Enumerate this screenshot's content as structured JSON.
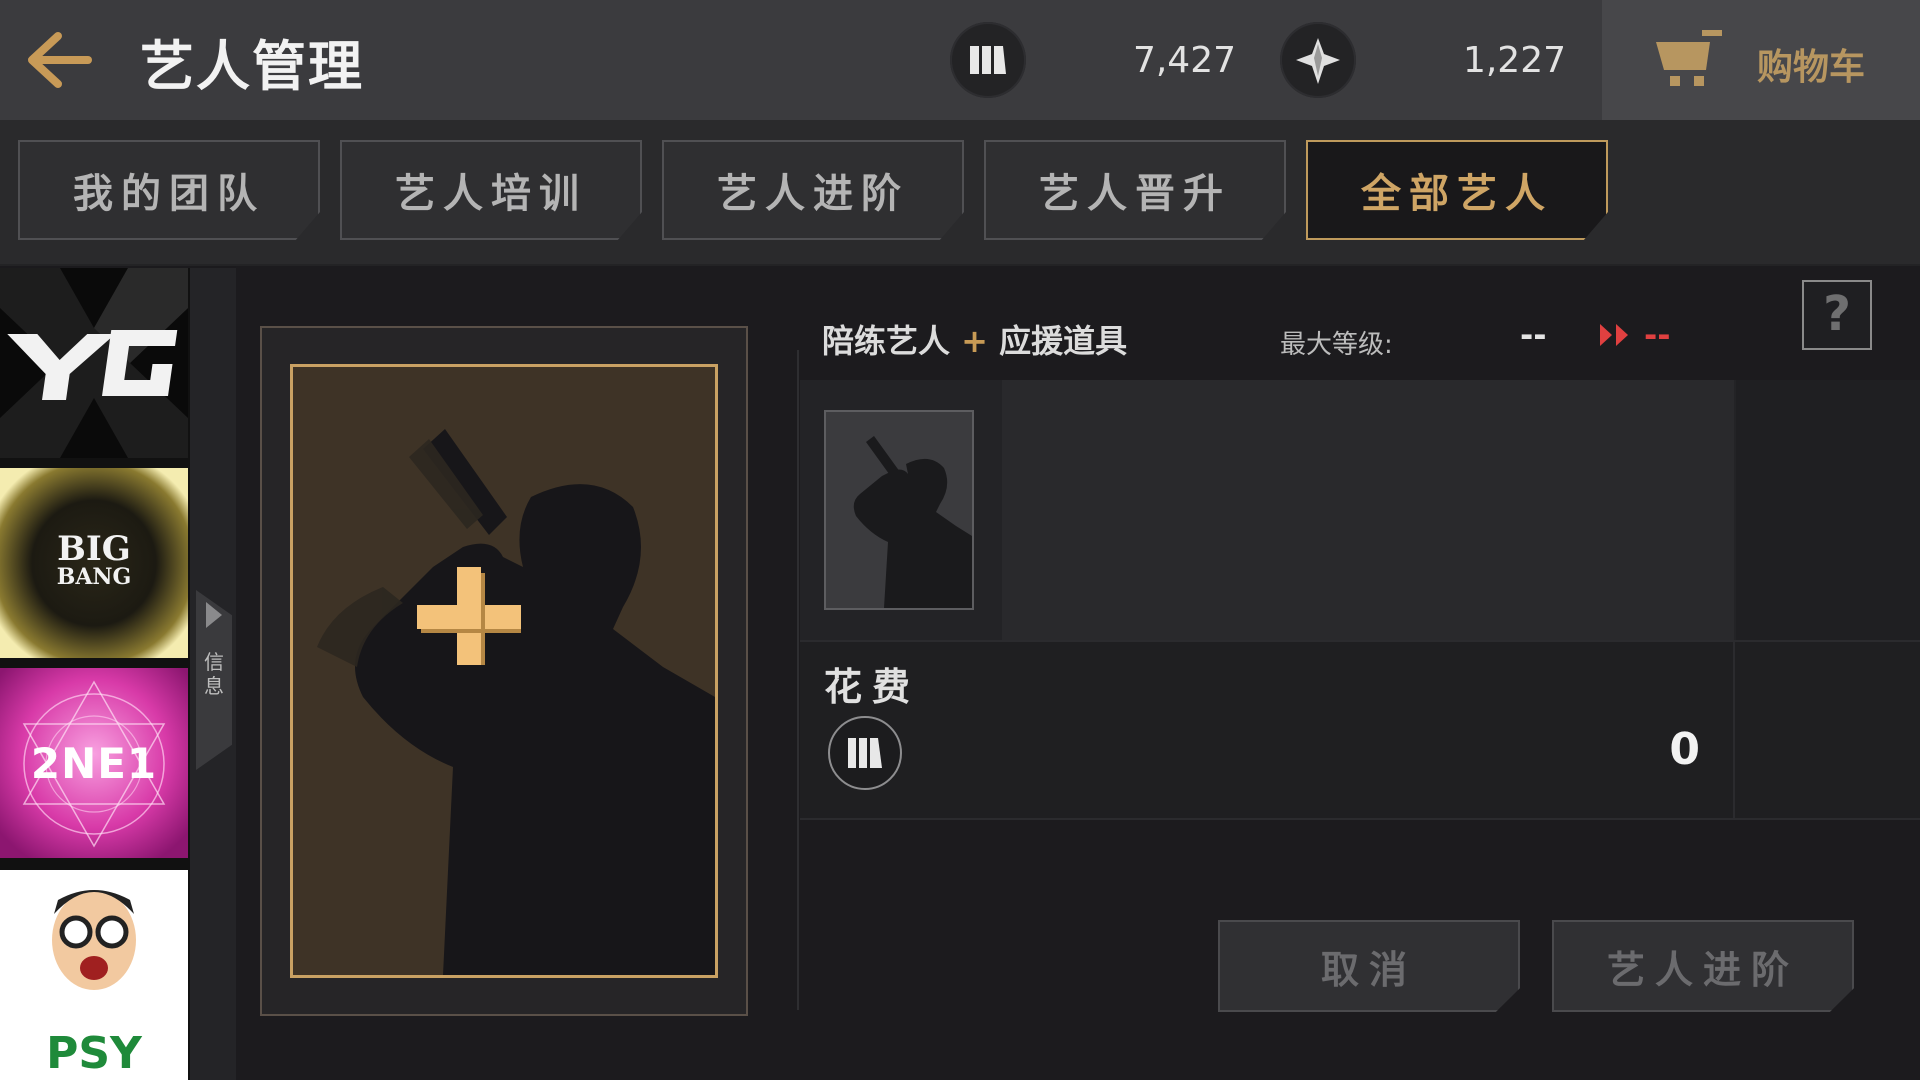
{
  "header": {
    "title": "艺人管理",
    "currency_1": {
      "icon": "ticket-bars-icon",
      "value": "7,427"
    },
    "currency_2": {
      "icon": "diamond-icon",
      "value": "1,227"
    },
    "cart_label": "购物车"
  },
  "tabs": [
    {
      "label": "我的团队",
      "active": false
    },
    {
      "label": "艺人培训",
      "active": false
    },
    {
      "label": "艺人进阶",
      "active": false
    },
    {
      "label": "艺人晋升",
      "active": false
    },
    {
      "label": "全部艺人",
      "active": true
    }
  ],
  "groups": [
    {
      "name": "YG",
      "logo": "yg-logo"
    },
    {
      "name": "BIG BANG",
      "logo": "bigbang-logo"
    },
    {
      "name": "2NE1",
      "logo": "2ne1-logo"
    },
    {
      "name": "PSY",
      "logo": "psy-logo"
    }
  ],
  "side_tab_label": "信息",
  "panel": {
    "title_left": "陪练艺人",
    "plus": "+",
    "title_right": "应援道具",
    "max_level_label": "最大等级:",
    "max_level_current": "--",
    "max_level_next": "--",
    "help": "?"
  },
  "cost": {
    "label": "花费",
    "value": "0"
  },
  "buttons": {
    "cancel": "取消",
    "advance": "艺人进阶"
  },
  "colors": {
    "accent": "#c9a163",
    "red": "#e04040",
    "tab_active_text": "#cfa565"
  }
}
